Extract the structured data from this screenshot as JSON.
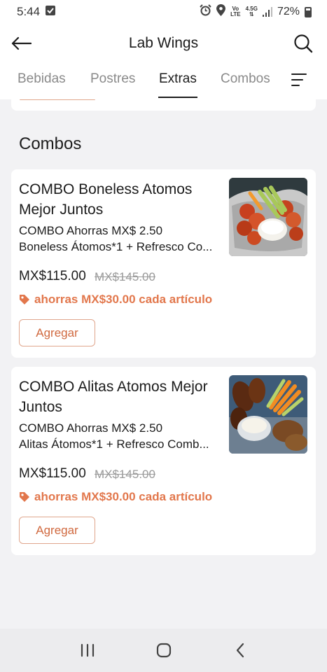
{
  "status": {
    "time": "5:44",
    "battery": "72%",
    "network_top": "Vo",
    "network_bottom": "LTE",
    "signal_label": "4.5G"
  },
  "header": {
    "title": "Lab Wings",
    "back_icon": "arrow-left-icon",
    "search_icon": "search-icon"
  },
  "tabs": [
    {
      "label": "Bebidas",
      "active": false
    },
    {
      "label": "Postres",
      "active": false
    },
    {
      "label": "Extras",
      "active": true
    },
    {
      "label": "Combos",
      "active": false
    }
  ],
  "section": {
    "title": "Combos"
  },
  "products": [
    {
      "name": "COMBO Boneless Atomos Mejor Juntos",
      "desc_line1": "COMBO Ahorras  MX$ 2.50",
      "desc_line2": "Boneless Átomos*1 + Refresco Co...",
      "price": "MX$115.00",
      "old_price": "MX$145.00",
      "saving": "ahorras MX$30.00 cada artículo",
      "button": "Agregar"
    },
    {
      "name": "COMBO Alitas Atomos Mejor Juntos",
      "desc_line1": "COMBO Ahorras  MX$ 2.50",
      "desc_line2": "Alitas Átomos*1 + Refresco Comb...",
      "price": "MX$115.00",
      "old_price": "MX$145.00",
      "saving": "ahorras MX$30.00 cada artículo",
      "button": "Agregar"
    }
  ],
  "colors": {
    "accent": "#e2774c",
    "button_text": "#d0693f",
    "button_border": "#e0a68c",
    "background": "#f2f2f4"
  }
}
